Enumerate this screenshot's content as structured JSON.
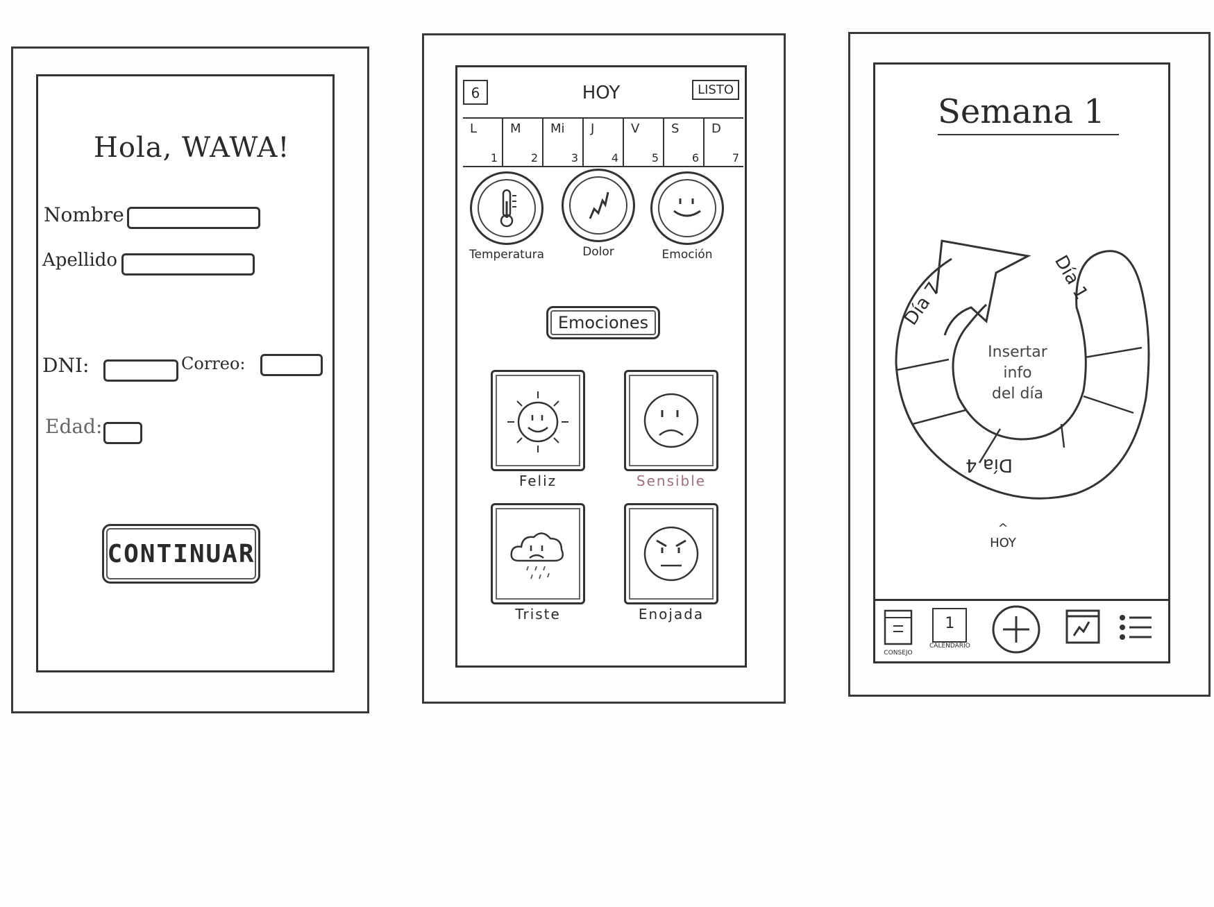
{
  "screen1": {
    "greeting": "Hola, WAWA!",
    "fields": {
      "nombre_label": "Nombre :",
      "apellido_label": "Apellido :",
      "dni_label": "DNI:",
      "correo_label": "Correo:",
      "edad_label": "Edad:"
    },
    "continue_label": "CONTINUAR"
  },
  "screen2": {
    "calendar_day": "6",
    "title": "HOY",
    "done_label": "LISTO",
    "week": [
      {
        "name": "L",
        "num": "1"
      },
      {
        "name": "M",
        "num": "2"
      },
      {
        "name": "Mi",
        "num": "3"
      },
      {
        "name": "J",
        "num": "4"
      },
      {
        "name": "V",
        "num": "5"
      },
      {
        "name": "S",
        "num": "6"
      },
      {
        "name": "D",
        "num": "7"
      }
    ],
    "categories": [
      {
        "label": "Temperatura",
        "icon": "thermometer-icon"
      },
      {
        "label": "Dolor",
        "icon": "lightning-icon"
      },
      {
        "label": "Emoción",
        "icon": "smiley-icon"
      }
    ],
    "section_button": "Emociones",
    "emotions": [
      {
        "label": "Feliz",
        "icon": "sun-smile-icon"
      },
      {
        "label": "Sensible",
        "icon": "sad-face-icon"
      },
      {
        "label": "Triste",
        "icon": "rain-cloud-icon"
      },
      {
        "label": "Enojada",
        "icon": "angry-face-icon"
      }
    ]
  },
  "screen3": {
    "title": "Semana 1",
    "segments": {
      "day1": "Día 1",
      "day7": "Día 7",
      "day4": "Día 4"
    },
    "center_text_1": "Insertar",
    "center_text_2": "info",
    "center_text_3": "del día",
    "today_marker": "^",
    "today_label": "HOY",
    "nav": [
      {
        "label": "CONSEJO",
        "icon": "book-icon"
      },
      {
        "label": "CALENDARIO",
        "icon": "calendar-icon",
        "day": "1"
      },
      {
        "label": "",
        "icon": "add-icon"
      },
      {
        "label": "",
        "icon": "chart-icon"
      },
      {
        "label": "",
        "icon": "menu-icon"
      }
    ]
  }
}
